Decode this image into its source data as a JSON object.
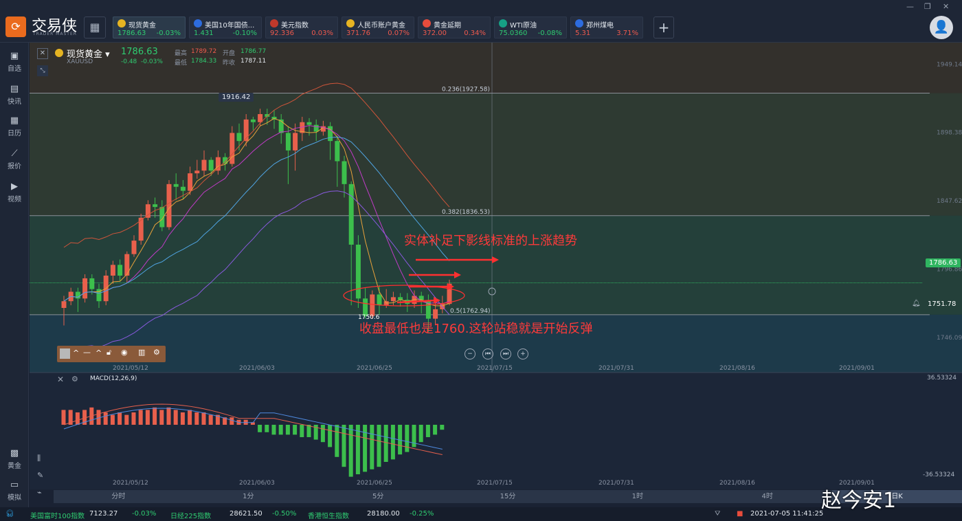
{
  "app": {
    "name": "交易侠",
    "subname": "TRADER MASTER"
  },
  "tickers": [
    {
      "name": "现货黄金",
      "price": "1786.63",
      "change": "-0.03%",
      "dir": "dn",
      "icon": "gold-icon",
      "iconColor": "#e6b422",
      "active": true
    },
    {
      "name": "美国10年国债...",
      "price": "1.431",
      "change": "-0.10%",
      "dir": "dn",
      "icon": "bar-chart-icon",
      "iconColor": "#2d6cdf",
      "active": false
    },
    {
      "name": "美元指数",
      "price": "92.336",
      "change": "0.03%",
      "dir": "up",
      "icon": "us-flag-icon",
      "iconColor": "#c0392b",
      "active": false
    },
    {
      "name": "人民币账户黄金",
      "price": "371.76",
      "change": "0.07%",
      "dir": "up",
      "icon": "gold-icon",
      "iconColor": "#e6b422",
      "active": false
    },
    {
      "name": "黄金延期",
      "price": "372.00",
      "change": "0.34%",
      "dir": "up",
      "icon": "gold-bars-icon",
      "iconColor": "#e74c3c",
      "active": false
    },
    {
      "name": "WTI原油",
      "price": "75.0360",
      "change": "-0.08%",
      "dir": "dn",
      "icon": "oil-icon",
      "iconColor": "#16a085",
      "active": false
    },
    {
      "name": "郑州煤电",
      "price": "5.31",
      "change": "3.71%",
      "dir": "up",
      "icon": "bar-chart-icon",
      "iconColor": "#2d6cdf",
      "active": false
    }
  ],
  "sidebar": {
    "top": [
      {
        "label": "自选",
        "icon": "bookmark-icon"
      },
      {
        "label": "快讯",
        "icon": "news-icon"
      },
      {
        "label": "日历",
        "icon": "calendar-icon"
      },
      {
        "label": "报价",
        "icon": "quote-chart-icon"
      },
      {
        "label": "视频",
        "icon": "video-icon"
      }
    ],
    "bottom": [
      {
        "label": "黄金",
        "icon": "gold-grid-icon"
      },
      {
        "label": "模拟",
        "icon": "wallet-icon"
      }
    ]
  },
  "instrument": {
    "name": "现货黄金",
    "code": "XAUUSD",
    "price": "1786.63",
    "change": "-0.48",
    "change_pct": "-0.03%",
    "high_label": "最高",
    "high": "1789.72",
    "open_label": "开盘",
    "open": "1786.77",
    "low_label": "最低",
    "low": "1784.33",
    "prev_label": "昨收",
    "prev": "1787.11"
  },
  "chart_data": {
    "type": "candlestick",
    "price_axis": {
      "ticks": [
        "1949.14",
        "1898.38",
        "1847.62",
        "1796.86",
        "1746.09"
      ],
      "ylim": [
        1720,
        1960
      ]
    },
    "date_axis": [
      "2021/05/12",
      "2021/06/03",
      "2021/06/25",
      "2021/07/15",
      "2021/07/31",
      "2021/08/16",
      "2021/09/01"
    ],
    "candles": [
      [
        1768,
        1773,
        1755,
        1777
      ],
      [
        1773,
        1780,
        1770,
        1783
      ],
      [
        1780,
        1775,
        1765,
        1783
      ],
      [
        1775,
        1790,
        1772,
        1793
      ],
      [
        1790,
        1782,
        1778,
        1793
      ],
      [
        1782,
        1773,
        1768,
        1786
      ],
      [
        1773,
        1792,
        1770,
        1796
      ],
      [
        1792,
        1800,
        1786,
        1803
      ],
      [
        1800,
        1792,
        1788,
        1804
      ],
      [
        1792,
        1808,
        1787,
        1810
      ],
      [
        1808,
        1818,
        1806,
        1822
      ],
      [
        1818,
        1835,
        1815,
        1838
      ],
      [
        1835,
        1845,
        1833,
        1848
      ],
      [
        1845,
        1843,
        1835,
        1850
      ],
      [
        1843,
        1828,
        1825,
        1848
      ],
      [
        1828,
        1860,
        1826,
        1863
      ],
      [
        1860,
        1858,
        1848,
        1868
      ],
      [
        1858,
        1855,
        1849,
        1863
      ],
      [
        1855,
        1868,
        1852,
        1873
      ],
      [
        1868,
        1870,
        1864,
        1878
      ],
      [
        1870,
        1878,
        1866,
        1885
      ],
      [
        1878,
        1870,
        1866,
        1880
      ],
      [
        1870,
        1880,
        1867,
        1885
      ],
      [
        1880,
        1875,
        1870,
        1883
      ],
      [
        1875,
        1898,
        1873,
        1903
      ],
      [
        1898,
        1892,
        1885,
        1905
      ],
      [
        1892,
        1908,
        1888,
        1912
      ],
      [
        1908,
        1906,
        1900,
        1910
      ],
      [
        1906,
        1912,
        1903,
        1916
      ],
      [
        1912,
        1910,
        1904,
        1916
      ],
      [
        1910,
        1908,
        1901,
        1915
      ],
      [
        1908,
        1898,
        1890,
        1912
      ],
      [
        1898,
        1885,
        1860,
        1903
      ],
      [
        1885,
        1898,
        1870,
        1905
      ],
      [
        1898,
        1906,
        1892,
        1910
      ],
      [
        1906,
        1904,
        1896,
        1909
      ],
      [
        1904,
        1899,
        1892,
        1908
      ],
      [
        1899,
        1903,
        1896,
        1907
      ],
      [
        1903,
        1892,
        1878,
        1906
      ],
      [
        1892,
        1877,
        1858,
        1896
      ],
      [
        1877,
        1860,
        1850,
        1881
      ],
      [
        1860,
        1815,
        1770,
        1862
      ],
      [
        1815,
        1775,
        1768,
        1822
      ],
      [
        1775,
        1762,
        1760,
        1783
      ],
      [
        1762,
        1778,
        1760,
        1781
      ],
      [
        1778,
        1770,
        1763,
        1785
      ],
      [
        1770,
        1773,
        1768,
        1782
      ],
      [
        1773,
        1776,
        1770,
        1780
      ],
      [
        1776,
        1774,
        1769,
        1779
      ],
      [
        1774,
        1771,
        1765,
        1779
      ],
      [
        1771,
        1777,
        1768,
        1781
      ],
      [
        1777,
        1773,
        1764,
        1780
      ],
      [
        1773,
        1760,
        1750,
        1778
      ],
      [
        1760,
        1767,
        1756,
        1776
      ],
      [
        1767,
        1771,
        1764,
        1777
      ],
      [
        1771,
        1786,
        1770,
        1789
      ]
    ],
    "fib_levels": [
      {
        "label": "0.236(1927.58)",
        "value": 1927.58
      },
      {
        "label": "0.382(1836.53)",
        "value": 1836.53
      },
      {
        "label": "0.5(1762.94)",
        "value": 1762.94
      }
    ],
    "current_price": "1786.63",
    "alert_price": "1751.78",
    "high_marker": "1916.42",
    "low_marker": "1750.6",
    "macd": {
      "label": "MACD(12,26,9)",
      "ymax": "36.53324",
      "ymin": "-36.53324",
      "hist": [
        6,
        6,
        5,
        6,
        7,
        6,
        5,
        4,
        5,
        4,
        5,
        6,
        6,
        7,
        6,
        7,
        6,
        5,
        6,
        5,
        5,
        4,
        4,
        3,
        3,
        2,
        2,
        1,
        -3,
        -3,
        -4,
        -4,
        -4,
        -4,
        -5,
        -5,
        -6,
        -7,
        -9,
        -13,
        -17,
        -21,
        -20,
        -19,
        -18,
        -17,
        -15,
        -14,
        -12,
        -11,
        -9,
        -7,
        -5,
        -4,
        -2
      ]
    }
  },
  "annotations": {
    "top": "实体补足下影线标准的上涨趋势",
    "bottom": "收盘最低也是1760.这轮站稳就是开始反弹"
  },
  "timeframes": [
    "分时",
    "1分",
    "5分",
    "15分",
    "1时",
    "4时",
    "日K"
  ],
  "statusbar": [
    {
      "name": "美国富时100指数",
      "price": "7123.27",
      "change": "-0.03%"
    },
    {
      "name": "日经225指数",
      "price": "28621.50",
      "change": "-0.50%"
    },
    {
      "name": "香港恒生指数",
      "price": "28180.00",
      "change": "-0.25%"
    }
  ],
  "datetime": "2021-07-05 11:41:25",
  "watermark": "赵今安1"
}
